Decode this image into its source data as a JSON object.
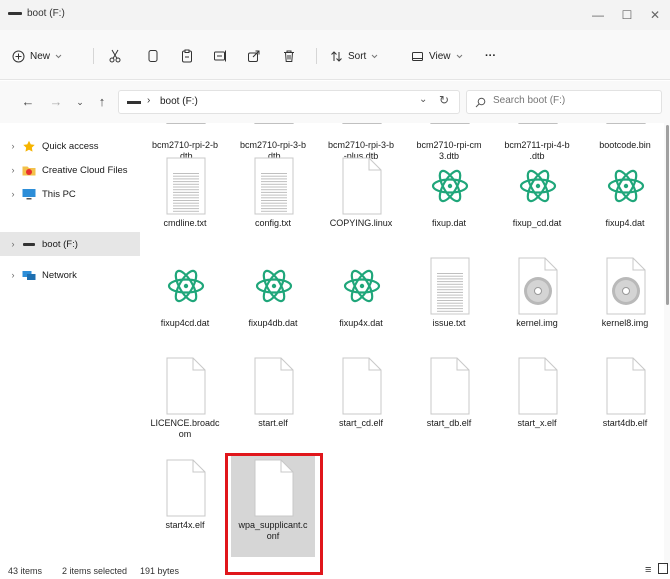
{
  "window": {
    "title": "boot (F:)",
    "minimize": "—",
    "maximize": "☐",
    "close": "✕"
  },
  "toolbar": {
    "new_label": "New",
    "sort_label": "Sort",
    "view_label": "View",
    "more_label": "···"
  },
  "address": {
    "path": "boot (F:)",
    "separator": "›"
  },
  "search": {
    "placeholder": "Search boot (F:)"
  },
  "sidebar": {
    "items": [
      {
        "label": "Quick access"
      },
      {
        "label": "Creative Cloud Files"
      },
      {
        "label": "This PC"
      },
      {
        "label": "boot (F:)"
      },
      {
        "label": "Network"
      }
    ]
  },
  "files": [
    {
      "name": "bcm2710-rpi-2-b.dtb",
      "line1": "bcm2710-rpi-2-b",
      "line2": ".dtb",
      "type": "partial"
    },
    {
      "name": "bcm2710-rpi-3-b.dtb",
      "line1": "bcm2710-rpi-3-b",
      "line2": ".dtb",
      "type": "partial"
    },
    {
      "name": "bcm2710-rpi-3-b-plus.dtb",
      "line1": "bcm2710-rpi-3-b",
      "line2": "-plus.dtb",
      "type": "partial"
    },
    {
      "name": "bcm2710-rpi-cm3.dtb",
      "line1": "bcm2710-rpi-cm",
      "line2": "3.dtb",
      "type": "partial"
    },
    {
      "name": "bcm2711-rpi-4-b.dtb",
      "line1": "bcm2711-rpi-4-b",
      "line2": ".dtb",
      "type": "partial"
    },
    {
      "name": "bootcode.bin",
      "line1": "bootcode.bin",
      "line2": "",
      "type": "partial"
    },
    {
      "name": "cmdline.txt",
      "line1": "cmdline.txt",
      "line2": "",
      "type": "text"
    },
    {
      "name": "config.txt",
      "line1": "config.txt",
      "line2": "",
      "type": "text"
    },
    {
      "name": "COPYING.linux",
      "line1": "COPYING.linux",
      "line2": "",
      "type": "blank"
    },
    {
      "name": "fixup.dat",
      "line1": "fixup.dat",
      "line2": "",
      "type": "atom"
    },
    {
      "name": "fixup_cd.dat",
      "line1": "fixup_cd.dat",
      "line2": "",
      "type": "atom"
    },
    {
      "name": "fixup4.dat",
      "line1": "fixup4.dat",
      "line2": "",
      "type": "atom"
    },
    {
      "name": "fixup4cd.dat",
      "line1": "fixup4cd.dat",
      "line2": "",
      "type": "atom"
    },
    {
      "name": "fixup4db.dat",
      "line1": "fixup4db.dat",
      "line2": "",
      "type": "atom"
    },
    {
      "name": "fixup4x.dat",
      "line1": "fixup4x.dat",
      "line2": "",
      "type": "atom"
    },
    {
      "name": "issue.txt",
      "line1": "issue.txt",
      "line2": "",
      "type": "text"
    },
    {
      "name": "kernel.img",
      "line1": "kernel.img",
      "line2": "",
      "type": "disc"
    },
    {
      "name": "kernel8.img",
      "line1": "kernel8.img",
      "line2": "",
      "type": "disc"
    },
    {
      "name": "LICENCE.broadcom",
      "line1": "LICENCE.broadc",
      "line2": "om",
      "type": "blank"
    },
    {
      "name": "start.elf",
      "line1": "start.elf",
      "line2": "",
      "type": "blank"
    },
    {
      "name": "start_cd.elf",
      "line1": "start_cd.elf",
      "line2": "",
      "type": "blank"
    },
    {
      "name": "start_db.elf",
      "line1": "start_db.elf",
      "line2": "",
      "type": "blank"
    },
    {
      "name": "start_x.elf",
      "line1": "start_x.elf",
      "line2": "",
      "type": "blank"
    },
    {
      "name": "start4db.elf",
      "line1": "start4db.elf",
      "line2": "",
      "type": "blank"
    },
    {
      "name": "start4x.elf",
      "line1": "start4x.elf",
      "line2": "",
      "type": "blank"
    },
    {
      "name": "wpa_supplicant.conf",
      "line1": "wpa_supplicant.c",
      "line2": "onf",
      "type": "blank",
      "selected": true
    }
  ],
  "status": {
    "count": "43 items",
    "selection": "2 items selected",
    "size": "191 bytes"
  },
  "colors": {
    "highlight": "#e0161b",
    "atom": "#1fa67a",
    "folder_star": "#f6b400"
  }
}
